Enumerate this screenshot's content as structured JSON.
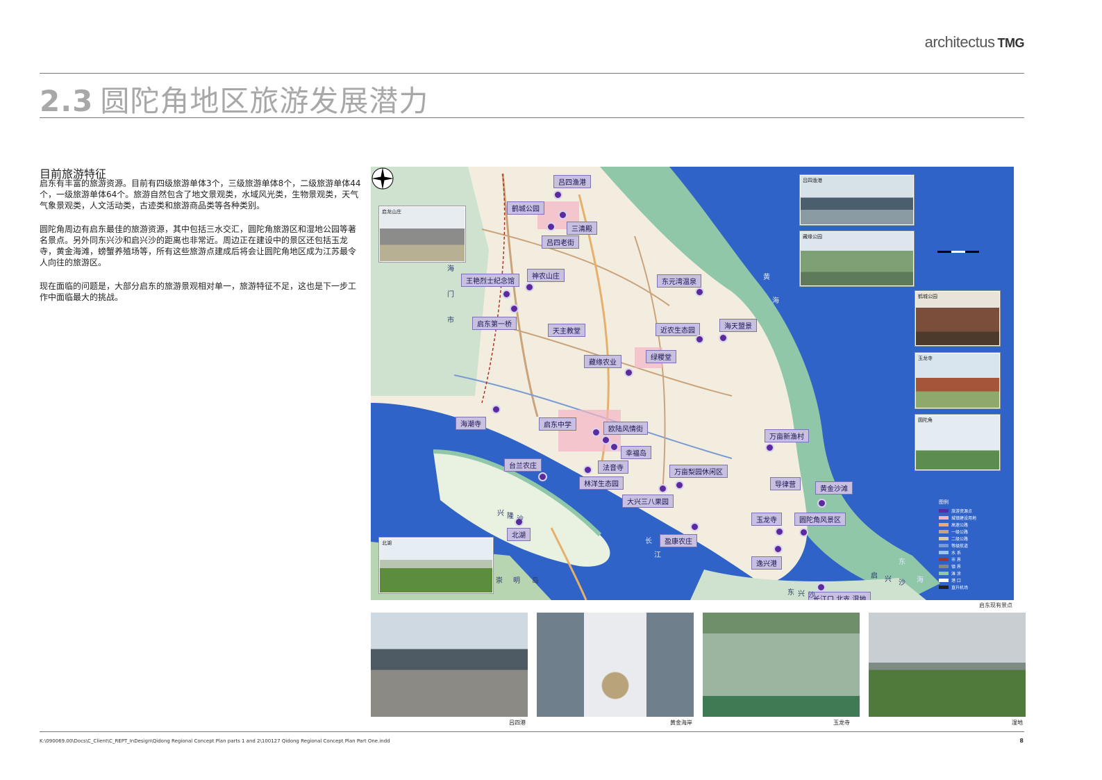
{
  "header": {
    "brand_light": "architectus",
    "brand_bold": "TMG"
  },
  "page": {
    "section_number": "2.3",
    "title": "圆陀角地区旅游发展潜力"
  },
  "intro": {
    "heading": "目前旅游特征",
    "paragraphs": [
      "启东有丰富的旅游资源。目前有四级旅游单体3个，三级旅游单体8个，二级旅游单体44个，一级旅游单体64个。旅游自然包含了地文景观类，水域风光类，生物景观类，天气气象景观类，人文活动类，古迹类和旅游商品类等各种类别。",
      "圆陀角周边有启东最佳的旅游资源，其中包括三水交汇，圆陀角旅游区和湿地公园等著名景点。另外同东兴沙和启兴沙的距离也非常近。周边正在建设中的景区还包括玉龙寺，黄金海滩，螃蟹养殖场等，所有这些旅游点建成后将会让圆陀角地区成为江苏最令人向往的旅游区。",
      "现在面临的问题是，大部分启东的旅游景观相对单一，旅游特征不足，这也是下一步工作中面临最大的挑战。"
    ]
  },
  "map": {
    "caption": "启东现有景点",
    "labels": [
      "吕四渔港",
      "鹤城公园",
      "三清殿",
      "吕四老街",
      "神农山庄",
      "王艳烈士纪念馆",
      "东元湾温泉",
      "启东第一桥",
      "天主教堂",
      "近农生态园",
      "海天盟景",
      "藏缘农业",
      "绿稷堂",
      "海潮寺",
      "启东中学",
      "欧陆风情街",
      "幸福岛",
      "万亩新渔村",
      "台兰农庄",
      "法音寺",
      "万亩梨园休闲区",
      "林洋生态园",
      "导律营",
      "大兴三八果园",
      "黄金沙滩",
      "玉龙寺",
      "圆陀角风景区",
      "北湖",
      "盈康农庄",
      "逸兴港",
      "长江口 北支 湿地"
    ],
    "place_names": [
      "海",
      "门",
      "市",
      "黄",
      "海",
      "长",
      "江",
      "东",
      "海",
      "崇",
      "明",
      "岛",
      "兴",
      "隆",
      "沙",
      "东",
      "兴",
      "沙",
      "启",
      "兴",
      "沙"
    ],
    "inset_photos": [
      "吕四渔港",
      "鹤城公园",
      "启龙山庄",
      "玉龙寺",
      "圆陀角",
      "北湖",
      "藏缘公园"
    ],
    "legend_title": "图例",
    "legend_items": [
      "旅游资源点",
      "城镇建设用地",
      "高速公路",
      "一级公路",
      "二级公路",
      "等级航道",
      "水 系",
      "市 界",
      "镇 界",
      "滩 涂",
      "港 口",
      "直升机场"
    ],
    "colors": {
      "sea": "#2f63c7",
      "land": "#f3ede0",
      "shore": "#8fc7a8",
      "pin": "#5b2b9e",
      "label_bg": "#c7c0e0"
    }
  },
  "photo_strip": [
    {
      "caption": "吕四港"
    },
    {
      "caption": "黄金海岸"
    },
    {
      "caption": "玉龙寺"
    },
    {
      "caption": "湿地"
    }
  ],
  "footer": {
    "path": "K:\\090069.00\\Docs\\C_Client\\C_REPT_InDesign\\Qidong Regional Concept Plan parts 1 and 2\\100127 Qidong Regional Concept Plan Part One.indd",
    "page_number": "8"
  }
}
